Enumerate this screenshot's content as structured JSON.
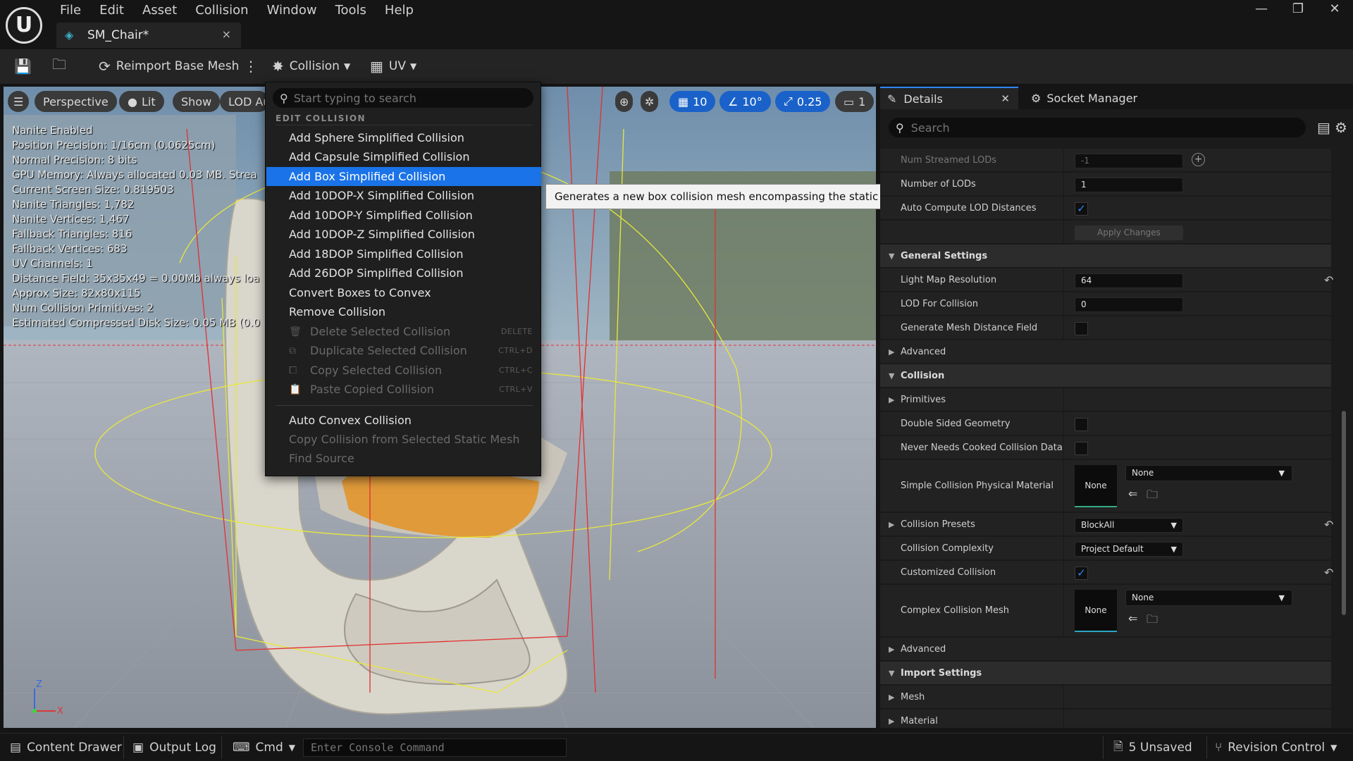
{
  "menu": [
    "File",
    "Edit",
    "Asset",
    "Collision",
    "Window",
    "Tools",
    "Help"
  ],
  "tab": {
    "name": "SM_Chair*",
    "close": "×"
  },
  "window_controls": [
    "—",
    "❐",
    "✕"
  ],
  "toolbar": {
    "reimport": "Reimport Base Mesh",
    "collision": "Collision",
    "uv": "UV"
  },
  "viewport": {
    "buttons": {
      "perspective": "Perspective",
      "lit": "Lit",
      "show": "Show",
      "lod": "LOD Au"
    },
    "snap": {
      "grid": "10",
      "angle": "10°",
      "scale": "0.25",
      "camera": "1"
    },
    "stats": [
      "Nanite Enabled",
      "Position Precision: 1/16cm (0.0625cm)",
      "Normal Precision: 8 bits",
      "GPU Memory: Always allocated 0.03 MB. Strea",
      "Current Screen Size: 0.819503",
      "Nanite Triangles: 1,782",
      "Nanite Vertices: 1,467",
      "Fallback Triangles: 816",
      "Fallback Vertices: 683",
      "UV Channels: 1",
      "Distance Field: 35x35x49 = 0.00Mb always loa",
      "Approx Size: 82x80x115",
      "Num Collision Primitives: 2",
      "Estimated Compressed Disk Size: 0.05 MB (0.0"
    ],
    "axis_z": "Z",
    "axis_x": "X"
  },
  "dropdown": {
    "search_placeholder": "Start typing to search",
    "section": "EDIT COLLISION",
    "items": [
      "Add Sphere Simplified Collision",
      "Add Capsule Simplified Collision",
      "Add Box Simplified Collision",
      "Add 10DOP-X Simplified Collision",
      "Add 10DOP-Y Simplified Collision",
      "Add 10DOP-Z Simplified Collision",
      "Add 18DOP Simplified Collision",
      "Add 26DOP Simplified Collision",
      "Convert Boxes to Convex",
      "Remove Collision"
    ],
    "disabled_items": [
      {
        "label": "Delete Selected Collision",
        "shortcut": "DELETE"
      },
      {
        "label": "Duplicate Selected Collision",
        "shortcut": "CTRL+D"
      },
      {
        "label": "Copy Selected Collision",
        "shortcut": "CTRL+C"
      },
      {
        "label": "Paste Copied Collision",
        "shortcut": "CTRL+V"
      }
    ],
    "lower_items": [
      {
        "label": "Auto Convex Collision",
        "enabled": true
      },
      {
        "label": "Copy Collision from Selected Static Mesh",
        "enabled": false
      },
      {
        "label": "Find Source",
        "enabled": false
      }
    ]
  },
  "tooltip": "Generates a new box collision mesh encompassing the static mesh.",
  "panel": {
    "tab_details": "Details",
    "tab_socket": "Socket Manager",
    "search_placeholder": "Search",
    "labels": {
      "num_streamed": "Num Streamed LODs",
      "num_streamed_val": "-1",
      "num_lods": "Number of LODs",
      "num_lods_val": "1",
      "auto_lod": "Auto Compute LOD Distances",
      "apply": "Apply Changes",
      "general": "General Settings",
      "lightmap": "Light Map Resolution",
      "lightmap_val": "64",
      "lod_coll": "LOD For Collision",
      "lod_coll_val": "0",
      "gen_df": "Generate Mesh Distance Field",
      "advanced1": "Advanced",
      "collision": "Collision",
      "primitives": "Primitives",
      "double_sided": "Double Sided Geometry",
      "never_cooked": "Never Needs Cooked Collision Data",
      "simple_mat": "Simple Collision Physical Material",
      "simple_mat_thumb": "None",
      "simple_mat_val": "None",
      "presets": "Collision Presets",
      "presets_val": "BlockAll",
      "complexity": "Collision Complexity",
      "complexity_val": "Project Default",
      "customized": "Customized Collision",
      "complex_mesh": "Complex Collision Mesh",
      "complex_mesh_thumb": "None",
      "complex_mesh_val": "None",
      "advanced2": "Advanced",
      "import": "Import Settings",
      "mesh": "Mesh",
      "material": "Material"
    }
  },
  "statusbar": {
    "content_drawer": "Content Drawer",
    "output_log": "Output Log",
    "cmd": "Cmd",
    "console_placeholder": "Enter Console Command",
    "unsaved": "5 Unsaved",
    "revision": "Revision Control"
  }
}
